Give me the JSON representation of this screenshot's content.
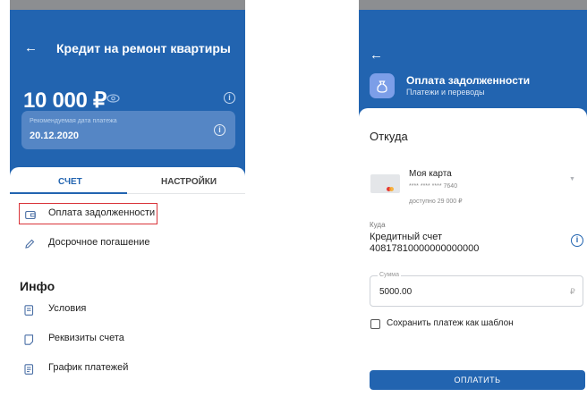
{
  "left": {
    "title": "Кредит на ремонт квартиры",
    "amount": "10 000 ₽",
    "recommended_label": "Рекомендуемая дата платежа",
    "recommended_date": "20.12.2020",
    "tabs": [
      {
        "label": "СЧЕТ",
        "active": true
      },
      {
        "label": "НАСТРОЙКИ",
        "active": false
      }
    ],
    "menu": [
      {
        "label": "Оплата задолженности",
        "icon": "wallet-icon",
        "highlighted": true
      },
      {
        "label": "Досрочное погашение",
        "icon": "pencil-icon",
        "highlighted": false
      }
    ],
    "info_section_title": "Инфо",
    "info_items": [
      {
        "label": "Условия",
        "icon": "document-icon"
      },
      {
        "label": "Реквизиты счета",
        "icon": "document-icon"
      },
      {
        "label": "График платежей",
        "icon": "document-icon"
      }
    ]
  },
  "right": {
    "title": "Оплата задолженности",
    "subtitle": "Платежи и переводы",
    "from_label": "Откуда",
    "card_name": "Моя карта",
    "card_number": "**** **** **** 7640",
    "card_available": "доступно 29 000 ₽",
    "to_caption": "Куда",
    "to_account_name": "Кредитный счет",
    "to_account_number": "40817810000000000000",
    "amount_label": "Сумма",
    "amount_value": "5000.00",
    "currency_symbol": "₽",
    "save_template_label": "Сохранить платеж как шаблон",
    "save_template_checked": false,
    "pay_button": "ОПЛАТИТЬ"
  },
  "colors": {
    "primary": "#2264b0",
    "card_block": "#5586c5",
    "highlight_border": "#d9343a",
    "status_bar": "#8c8e91"
  }
}
